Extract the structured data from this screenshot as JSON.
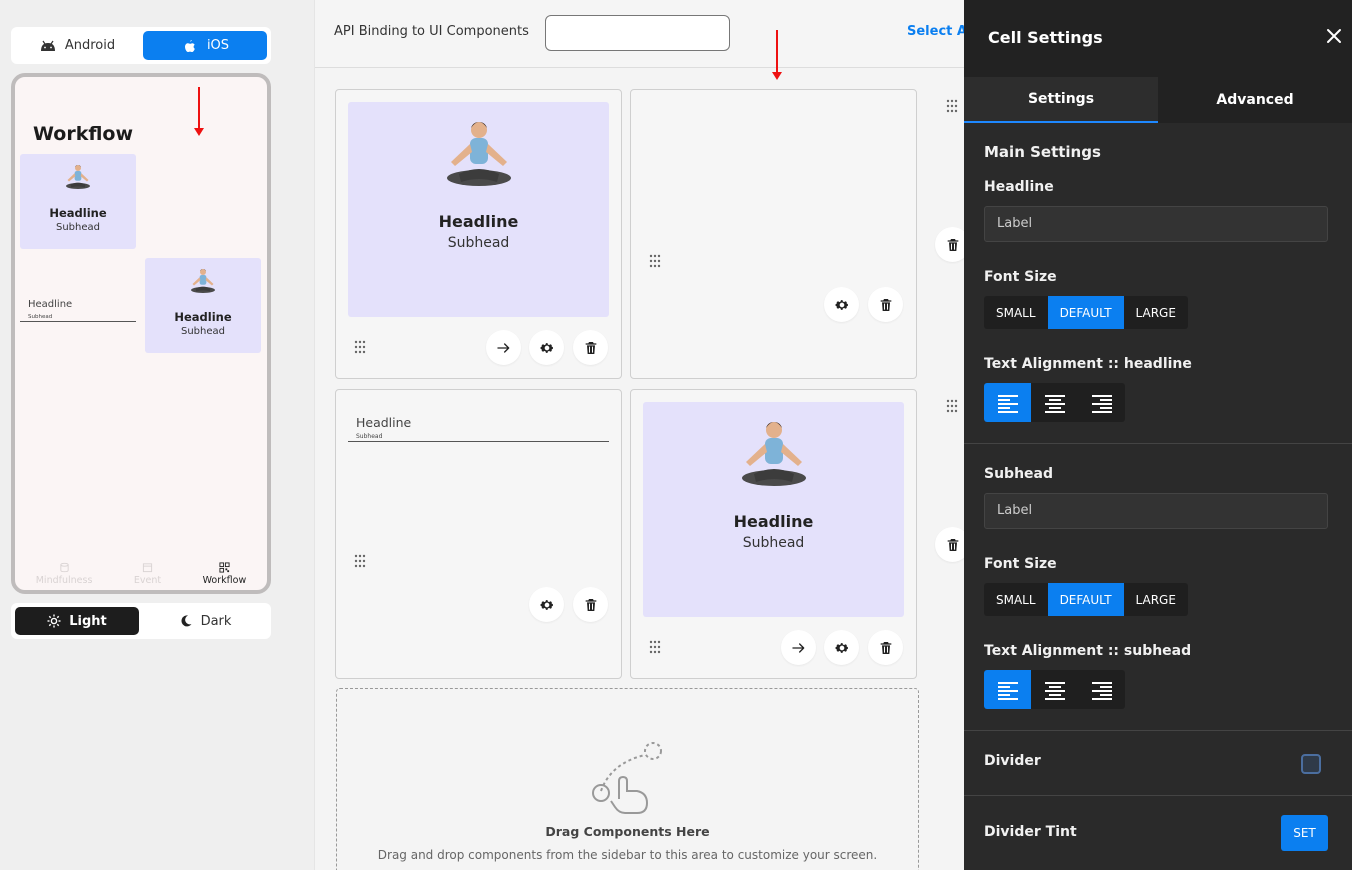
{
  "os_toggle": {
    "android": "Android",
    "ios": "iOS"
  },
  "phone": {
    "title": "Workflow",
    "card1": {
      "headline": "Headline",
      "subhead": "Subhead"
    },
    "card2": {
      "headline": "Headline",
      "subhead": "Subhead"
    },
    "input": {
      "headline": "Headline",
      "subhead": "Subhead"
    },
    "nav": [
      "Mindfulness",
      "Event",
      "Workflow"
    ]
  },
  "theme_toggle": {
    "light": "Light",
    "dark": "Dark"
  },
  "topbar": {
    "label": "API Binding to UI Components",
    "select": "Select Al"
  },
  "cells": {
    "c1": {
      "headline": "Headline",
      "subhead": "Subhead"
    },
    "c3": {
      "headline": "Headline",
      "subhead": "Subhead"
    },
    "c4": {
      "headline": "Headline",
      "subhead": "Subhead"
    }
  },
  "drop": {
    "title": "Drag Components Here",
    "desc": "Drag and drop components from the sidebar to this area to customize your screen."
  },
  "panel": {
    "title": "Cell Settings",
    "tabs": [
      "Settings",
      "Advanced"
    ],
    "main_settings": "Main Settings",
    "headline_label": "Headline",
    "headline_value": "Label",
    "font_size_label": "Font Size",
    "sizes": [
      "SMALL",
      "DEFAULT",
      "LARGE"
    ],
    "align_headline": "Text Alignment :: headline",
    "subhead_label": "Subhead",
    "subhead_value": "Label",
    "font_size_label2": "Font Size",
    "align_subhead": "Text Alignment :: subhead",
    "divider_label": "Divider",
    "divider_tint_label": "Divider Tint",
    "set_label": "SET"
  },
  "colors": {
    "accent": "#0b7ff0",
    "card_bg": "#e4e1fb",
    "panel_bg": "#2a2a2a"
  }
}
